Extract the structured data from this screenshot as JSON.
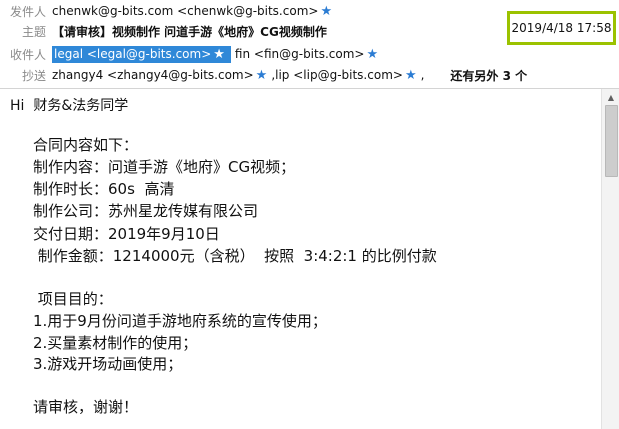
{
  "header": {
    "from": {
      "label": "发件人",
      "value": "chenwk@g-bits.com <chenwk@g-bits.com>",
      "icon": "star-icon"
    },
    "subject": {
      "label": "主题",
      "value": "【请审核】视频制作 问道手游《地府》CG视频制作"
    },
    "date": "2019/4/18 17:58",
    "to": {
      "label": "收件人",
      "recipients": [
        {
          "text": "legal <legal@g-bits.com>",
          "selected": true
        },
        {
          "text": "fin <fin@g-bits.com>",
          "selected": false
        }
      ]
    },
    "cc": {
      "label": "抄送",
      "recipients": [
        {
          "text": "zhangy4 <zhangy4@g-bits.com>"
        },
        {
          "text": "lip <lip@g-bits.com>"
        }
      ],
      "more": "还有另外 3 个"
    }
  },
  "body": {
    "lines": [
      "Hi  财务&法务同学",
      "",
      "合同内容如下：",
      "制作内容：问道手游《地府》CG视频；",
      "制作时长：60s  高清",
      "制作公司：苏州星龙传媒有限公司",
      "交付日期：2019年9月10日",
      " 制作金额：1214000元（含税）  按照  3:4:2:1 的比例付款",
      "",
      " 项目目的：",
      "1.用于9月份问道手游地府系统的宣传使用；",
      "2.买量素材制作的使用；",
      "3.游戏开场动画使用；",
      "",
      "请审核，谢谢！"
    ]
  },
  "colors": {
    "star": "#2b7cd3",
    "highlight": "#2f88d8",
    "datebox_border": "#9bc200",
    "label": "#8a8a8a"
  }
}
